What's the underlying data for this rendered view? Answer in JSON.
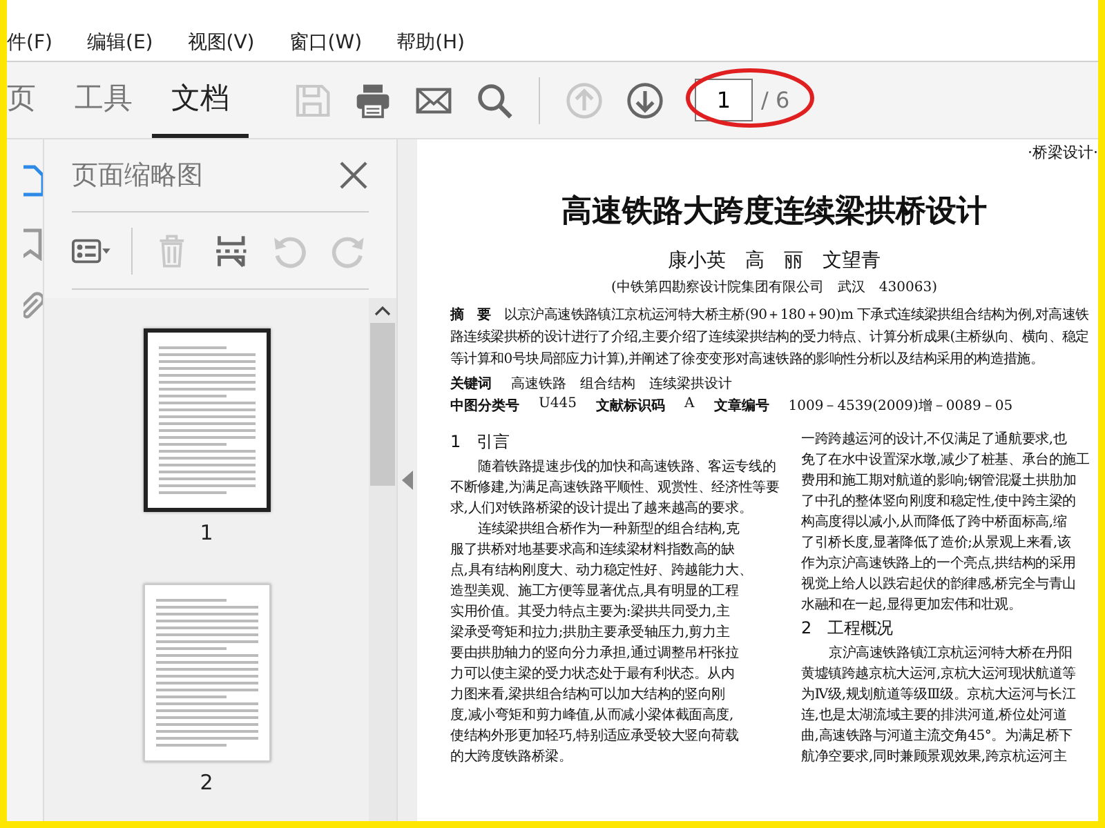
{
  "menu": [
    "件(F)",
    "编辑(E)",
    "视图(V)",
    "窗口(W)",
    "帮助(H)"
  ],
  "tabs": [
    {
      "label": "页",
      "selected": false
    },
    {
      "label": "工具",
      "selected": false
    },
    {
      "label": "文档",
      "selected": true
    }
  ],
  "toolbar": [
    {
      "kind": "save",
      "disabled": true
    },
    {
      "kind": "print",
      "disabled": false
    },
    {
      "kind": "mail",
      "disabled": false
    },
    {
      "kind": "search",
      "disabled": false
    },
    {
      "kind": "sep"
    },
    {
      "kind": "up",
      "disabled": true
    },
    {
      "kind": "down",
      "disabled": false
    }
  ],
  "page_field": {
    "value": "1",
    "total": "/ 6"
  },
  "side_strip": [
    {
      "kind": "pages",
      "selected": true
    },
    {
      "kind": "bookmark",
      "selected": false
    },
    {
      "kind": "clip",
      "selected": false
    }
  ],
  "panel": {
    "title": "页面缩略图",
    "tools": [
      {
        "kind": "options",
        "disabled": false
      },
      {
        "kind": "sep"
      },
      {
        "kind": "trash",
        "disabled": true
      },
      {
        "kind": "insert",
        "disabled": false
      },
      {
        "kind": "undo",
        "disabled": true
      },
      {
        "kind": "redo",
        "disabled": true
      }
    ],
    "thumbnails": [
      {
        "label": "1",
        "selected": true
      },
      {
        "label": "2",
        "selected": false
      }
    ]
  },
  "document": {
    "section": "·桥梁设计·",
    "title": "高速铁路大跨度连续梁拱桥设计",
    "authors": "康小英　高　丽　文望青",
    "affiliation": "(中铁第四勘察设计院集团有限公司　武汉　430063)",
    "abstract": "**摘　要**　以京沪高速铁路镇江京杭运河特大桥主桥(90＋180＋90)m 下承式连续梁拱组合结构为例,对高速铁路连续梁拱桥的设计进行了介绍,主要介绍了连续梁拱结构的受力特点、计算分析成果(主桥纵向、横向、稳定等计算和0号块局部应力计算),并阐述了徐变变形对高速铁路的影响性分析以及结构采用的构造措施。",
    "keywords": {
      "label": "关键词",
      "value": "高速铁路　组合结构　连续梁拱设计"
    },
    "classification": [
      {
        "label": "中图分类号",
        "value": "U445"
      },
      {
        "label": "文献标识码",
        "value": "A"
      },
      {
        "label": "文章编号",
        "value": "1009－4539(2009)增－0089－05"
      }
    ],
    "left_column": [
      {
        "kind": "heading",
        "text": "1　引言"
      },
      {
        "kind": "indent",
        "text": "随着铁路提速步伐的加快和高速铁路、客运专线的"
      },
      {
        "kind": "line",
        "text": "不断修建,为满足高速铁路平顺性、观赏性、经济性等要"
      },
      {
        "kind": "line",
        "text": "求,人们对铁路桥梁的设计提出了越来越高的要求。"
      },
      {
        "kind": "indent",
        "text": "连续梁拱组合桥作为一种新型的组合结构,克"
      },
      {
        "kind": "line",
        "text": "服了拱桥对地基要求高和连续梁材料指数高的缺"
      },
      {
        "kind": "line",
        "text": "点,具有结构刚度大、动力稳定性好、跨越能力大、"
      },
      {
        "kind": "line",
        "text": "造型美观、施工方便等显著优点,具有明显的工程"
      },
      {
        "kind": "line",
        "text": "实用价值。其受力特点主要为:梁拱共同受力,主"
      },
      {
        "kind": "line",
        "text": "梁承受弯矩和拉力;拱肋主要承受轴压力,剪力主"
      },
      {
        "kind": "line",
        "text": "要由拱肋轴力的竖向分力承担,通过调整吊杆张拉"
      },
      {
        "kind": "line",
        "text": "力可以使主梁的受力状态处于最有利状态。从内"
      },
      {
        "kind": "line",
        "text": "力图来看,梁拱组合结构可以加大结构的竖向刚"
      },
      {
        "kind": "line",
        "text": "度,减小弯矩和剪力峰值,从而减小梁体截面高度,"
      },
      {
        "kind": "line",
        "text": "使结构外形更加轻巧,特别适应承受较大竖向荷载"
      },
      {
        "kind": "line",
        "text": "的大跨度铁路桥梁。"
      }
    ],
    "right_column": [
      {
        "kind": "line",
        "text": "一跨跨越运河的设计,不仅满足了通航要求,也"
      },
      {
        "kind": "line",
        "text": "免了在水中设置深水墩,减少了桩基、承台的施工"
      },
      {
        "kind": "line",
        "text": "费用和施工期对航道的影响;钢管混凝土拱肋加"
      },
      {
        "kind": "line",
        "text": "了中孔的整体竖向刚度和稳定性,使中跨主梁的"
      },
      {
        "kind": "line",
        "text": "构高度得以减小,从而降低了跨中桥面标高,缩"
      },
      {
        "kind": "line",
        "text": "了引桥长度,显著降低了造价;从景观上来看,该"
      },
      {
        "kind": "line",
        "text": "作为京沪高速铁路上的一个亮点,拱结构的采用"
      },
      {
        "kind": "line",
        "text": "视觉上给人以跌宕起伏的韵律感,桥完全与青山"
      },
      {
        "kind": "line",
        "text": "水融和在一起,显得更加宏伟和壮观。"
      },
      {
        "kind": "heading",
        "text": "2　工程概况"
      },
      {
        "kind": "indent",
        "text": "京沪高速铁路镇江京杭运河特大桥在丹阳"
      },
      {
        "kind": "line",
        "text": "黄墟镇跨越京杭大运河,京杭大运河现状航道等"
      },
      {
        "kind": "line",
        "text": "为Ⅳ级,规划航道等级Ⅲ级。京杭大运河与长江"
      },
      {
        "kind": "line",
        "text": "连,也是太湖流域主要的排洪河道,桥位处河道"
      },
      {
        "kind": "line",
        "text": "曲,高速铁路与河道主流交角45°。为满足桥下"
      },
      {
        "kind": "line",
        "text": "航净空要求,同时兼顾景观效果,跨京杭运河主"
      }
    ]
  }
}
